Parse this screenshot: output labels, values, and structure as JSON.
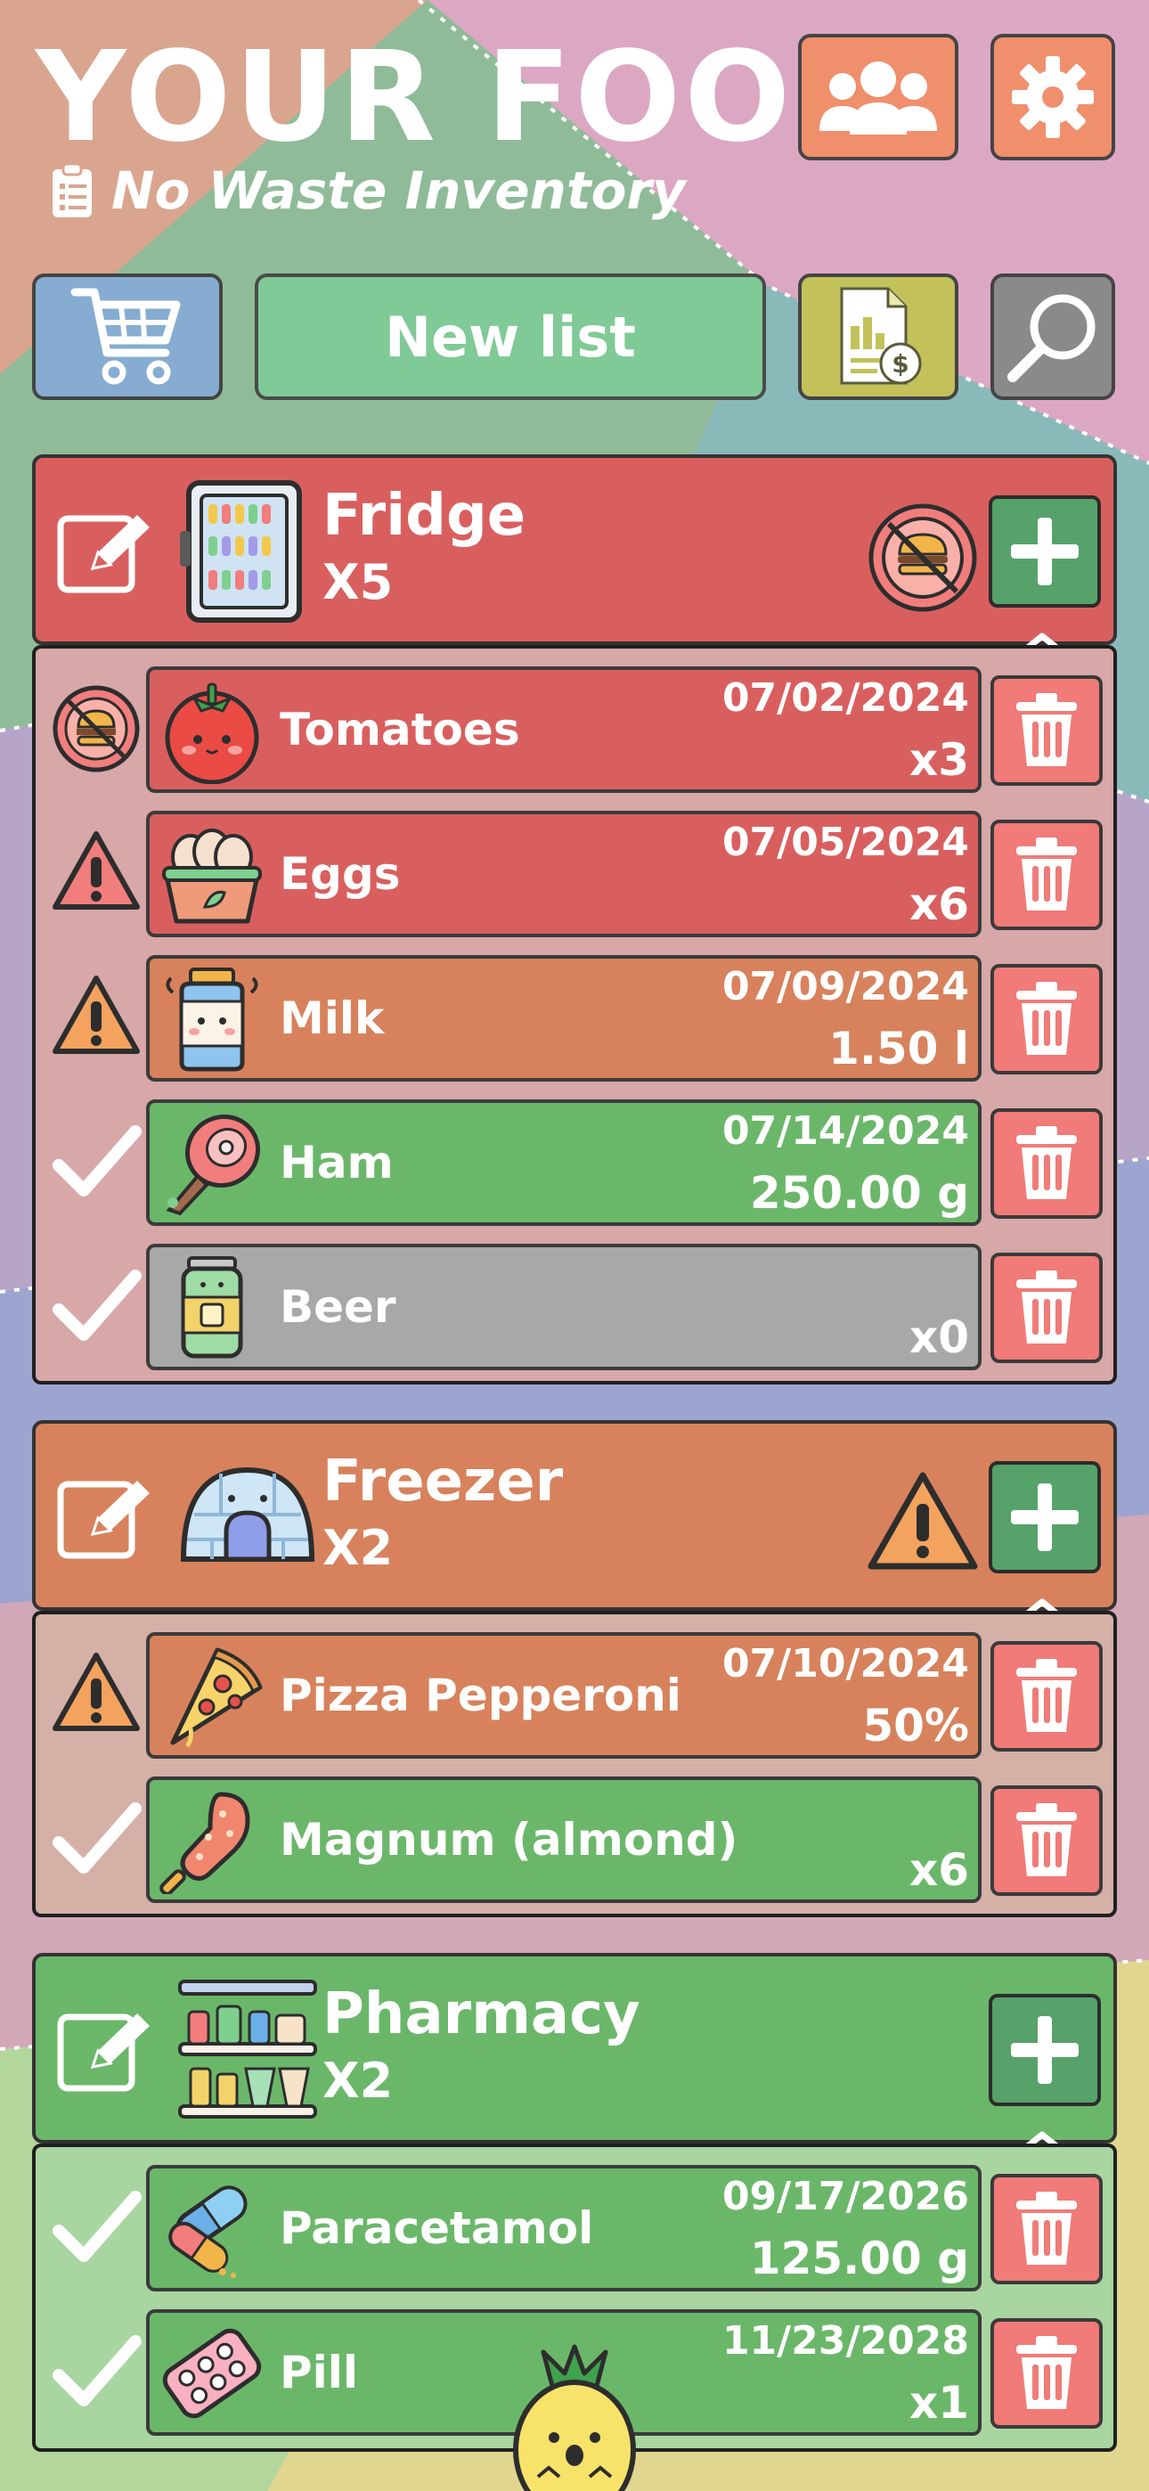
{
  "app": {
    "title": "YOUR FOOD",
    "subtitle": "No Waste Inventory"
  },
  "toolbar": {
    "new_list_label": "New list",
    "cart_icon": "shopping-cart-icon",
    "users_icon": "users-icon",
    "settings_icon": "gear-icon",
    "bill_icon": "invoice-icon",
    "search_icon": "search-icon"
  },
  "colors": {
    "red": "#d95f5f",
    "orange": "#d7825c",
    "green": "#6bb76a",
    "gray": "#a8a8a8",
    "trash": "#f07b78",
    "add": "#56a26a",
    "cart_btn": "#86acd1",
    "users_btn": "#f08f6c",
    "bill_btn": "#c2c15a",
    "search_btn": "#8a8a8a"
  },
  "sections": [
    {
      "name": "Fridge",
      "count": "X5",
      "status_icon": "expired-burger-icon",
      "items": [
        {
          "name": "Tomatoes",
          "date": "07/02/2024",
          "qty": "x3",
          "status": "expired"
        },
        {
          "name": "Eggs",
          "date": "07/05/2024",
          "qty": "x6",
          "status": "danger"
        },
        {
          "name": "Milk",
          "date": "07/09/2024",
          "qty": "1.50 l",
          "status": "warning"
        },
        {
          "name": "Ham",
          "date": "07/14/2024",
          "qty": "250.00 g",
          "status": "ok"
        },
        {
          "name": "Beer",
          "date": "",
          "qty": "x0",
          "status": "ok-empty"
        }
      ]
    },
    {
      "name": "Freezer",
      "count": "X2",
      "status_icon": "warning-icon",
      "items": [
        {
          "name": "Pizza Pepperoni",
          "date": "07/10/2024",
          "qty": "50%",
          "status": "warning"
        },
        {
          "name": "Magnum (almond)",
          "date": "",
          "qty": "x6",
          "status": "ok"
        }
      ]
    },
    {
      "name": "Pharmacy",
      "count": "X2",
      "status_icon": "",
      "items": [
        {
          "name": "Paracetamol",
          "date": "09/17/2026",
          "qty": "125.00 g",
          "status": "ok"
        },
        {
          "name": "Pill",
          "date": "11/23/2028",
          "qty": "x1",
          "status": "ok"
        }
      ]
    }
  ]
}
